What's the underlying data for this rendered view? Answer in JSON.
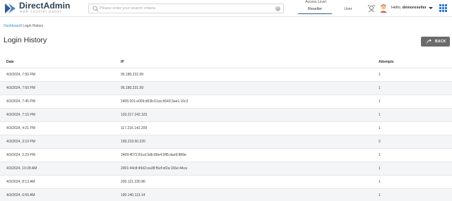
{
  "brand": {
    "name": "DirectAdmin",
    "tagline": "web control panel"
  },
  "search": {
    "placeholder": "Please enter your search criteria"
  },
  "access": {
    "label": "Access Level",
    "tabs": [
      "Reseller",
      "User"
    ],
    "active": "Reseller"
  },
  "user": {
    "greeting": "Hello,",
    "name": "demoreseller"
  },
  "breadcrumb": {
    "root": "Dashboard",
    "separator": "/",
    "current": "Login History"
  },
  "page": {
    "title": "Login History",
    "back_label": "BACK"
  },
  "table": {
    "headers": {
      "date": "Date",
      "ip": "IP",
      "attempts": "Attempts"
    },
    "rows": [
      {
        "date": "4/3/2024, 7:50 PM",
        "ip": "95.180.231.99",
        "attempts": "1"
      },
      {
        "date": "4/3/2024, 7:50 PM",
        "ip": "95.180.231.99",
        "attempts": "1"
      },
      {
        "date": "4/3/2024, 7:45 PM",
        "ip": "2405:201:e009:d03b:61ac:b549:3ae1:10c2",
        "attempts": "1"
      },
      {
        "date": "4/3/2024, 7:15 PM",
        "ip": "103.217.242.181",
        "attempts": "1"
      },
      {
        "date": "4/3/2024, 4:21 PM",
        "ip": "117.216.142.209",
        "attempts": "1"
      },
      {
        "date": "4/3/2024, 3:10 PM",
        "ip": "190.219.50.220",
        "attempts": "2"
      },
      {
        "date": "4/3/2024, 2:23 PM",
        "ip": "2409:4072:81cd:3db:89e4:5ff5:dae9:889e",
        "attempts": "1"
      },
      {
        "date": "4/3/2024, 10:28 AM",
        "ip": "2001:44c8:45d2:ea38:f5ef:ef2a:166e:44ca",
        "attempts": "1"
      },
      {
        "date": "4/3/2024, 8:13 AM",
        "ip": "200.121.230.86",
        "attempts": "1"
      },
      {
        "date": "4/3/2024, 6:56 AM",
        "ip": "190.140.113.14",
        "attempts": "1"
      }
    ]
  },
  "colors": {
    "brand_blue": "#2d5f96",
    "link": "#3a8ed8",
    "back_button": "#6b6b6b",
    "stripe": "#f4f5f7"
  }
}
